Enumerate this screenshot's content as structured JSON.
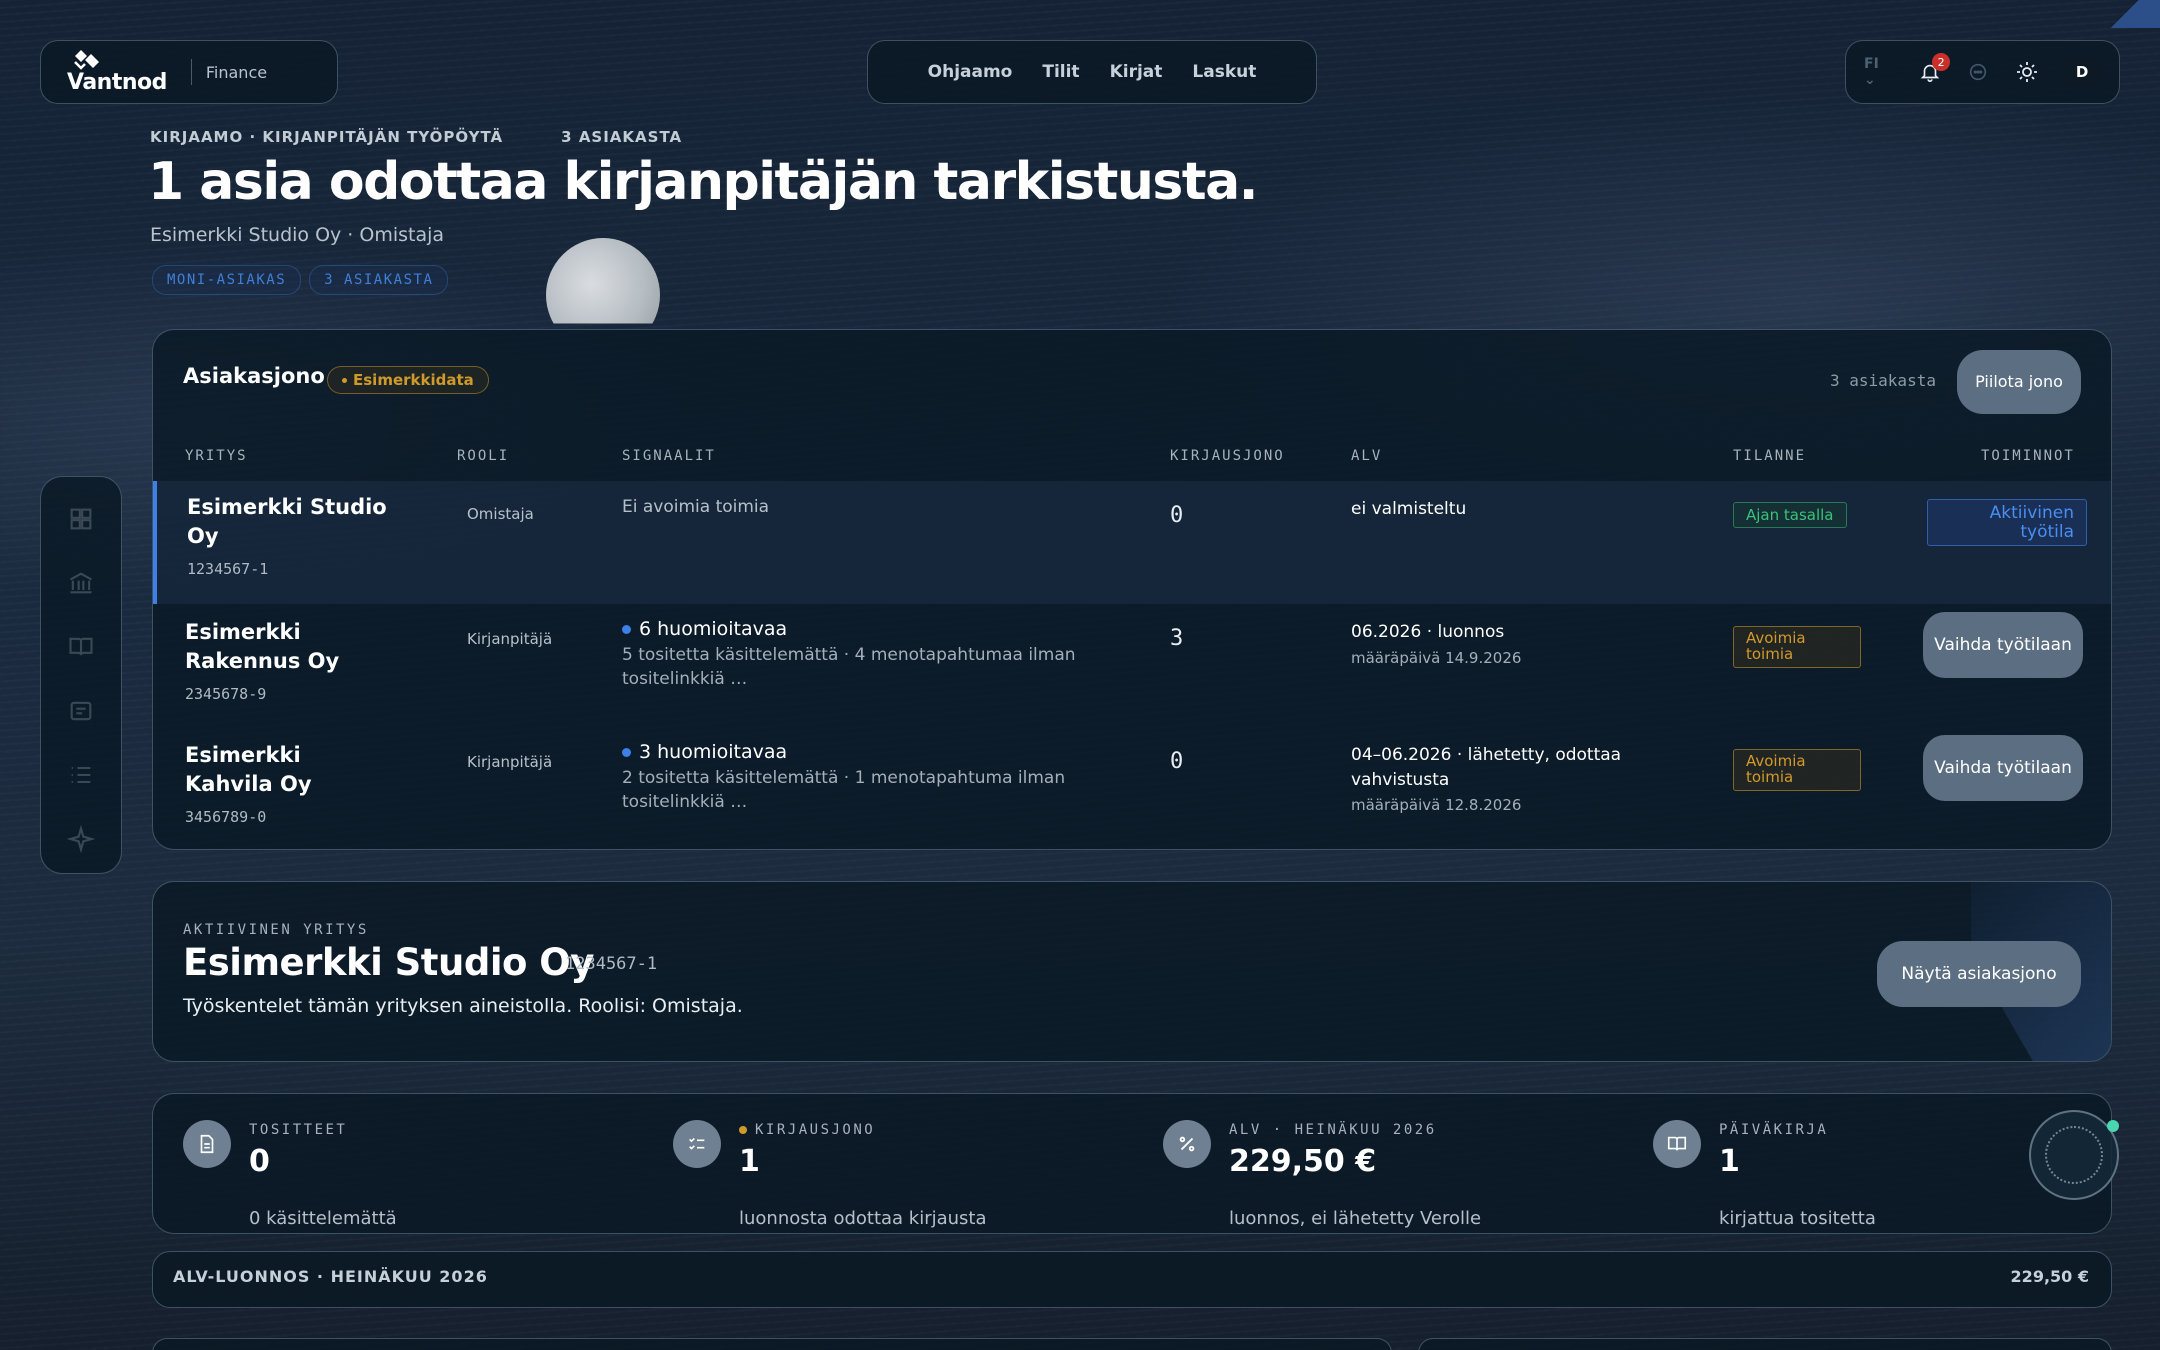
{
  "brand": {
    "name": "Vantnod",
    "product": "Finance"
  },
  "nav": {
    "items": [
      "Ohjaamo",
      "Tilit",
      "Kirjat",
      "Laskut"
    ]
  },
  "utility": {
    "lang": "FI",
    "notification_count": "2",
    "avatar_initial": "D"
  },
  "hero": {
    "eyebrow": "KIRJAAMO · KIRJANPITÄJÄN TYÖPÖYTÄ",
    "eyebrow_count": "3 ASIAKASTA",
    "headline": "1 asia odottaa kirjanpitäjän tarkistusta.",
    "subline": "Esimerkki Studio Oy · Omistaja",
    "chips": [
      "MONI-ASIAKAS",
      "3 ASIAKASTA"
    ]
  },
  "queue": {
    "title": "Asiakasjono",
    "demo_badge": "Esimerkkidata",
    "count": "3 asiakasta",
    "hide_button": "Piilota jono",
    "columns": [
      "YRITYS",
      "ROOLI",
      "SIGNAALIT",
      "KIRJAUSJONO",
      "ALV",
      "TILANNE",
      "TOIMINNOT"
    ],
    "rows": [
      {
        "name": "Esimerkki Studio Oy",
        "id": "1234567-1",
        "role": "Omistaja",
        "signal_none": "Ei avoimia toimia",
        "signal_main": "",
        "signal_sub": "",
        "queue": "0",
        "alv_main": "ei valmisteltu",
        "alv_sub": "",
        "status": "Ajan tasalla",
        "action": "Aktiivinen työtila"
      },
      {
        "name": "Esimerkki Rakennus Oy",
        "id": "2345678-9",
        "role": "Kirjanpitäjä",
        "signal_none": "",
        "signal_main": "6 huomioitavaa",
        "signal_sub": "5 tositetta käsittelemättä · 4 menotapahtumaa ilman tositelinkkiä …",
        "queue": "3",
        "alv_main": "06.2026 · luonnos",
        "alv_sub": "määräpäivä 14.9.2026",
        "status": "Avoimia toimia",
        "action": "Vaihda työtilaan"
      },
      {
        "name": "Esimerkki Kahvila Oy",
        "id": "3456789-0",
        "role": "Kirjanpitäjä",
        "signal_none": "",
        "signal_main": "3 huomioitavaa",
        "signal_sub": "2 tositetta käsittelemättä · 1 menotapahtuma ilman tositelinkkiä …",
        "queue": "0",
        "alv_main": "04–06.2026 · lähetetty, odottaa vahvistusta",
        "alv_sub": "määräpäivä 12.8.2026",
        "status": "Avoimia toimia",
        "action": "Vaihda työtilaan"
      }
    ]
  },
  "active_company": {
    "label": "AKTIIVINEN YRITYS",
    "name": "Esimerkki Studio Oy",
    "id": "1234567-1",
    "description": "Työskentelet tämän yrityksen aineistolla. Roolisi: Omistaja.",
    "button": "Näytä asiakasjono"
  },
  "stats": [
    {
      "label": "TOSITTEET",
      "value": "0",
      "sub": "0 käsittelemättä",
      "icon": "document-icon"
    },
    {
      "label": "KIRJAUSJONO",
      "value": "1",
      "sub": "luonnosta odottaa kirjausta",
      "icon": "checklist-icon"
    },
    {
      "label": "ALV · HEINÄKUU 2026",
      "value": "229,50 €",
      "sub": "luonnos, ei lähetetty Verolle",
      "icon": "percent-icon"
    },
    {
      "label": "PÄIVÄKIRJA",
      "value": "1",
      "sub": "kirjattua tositetta",
      "icon": "book-icon"
    }
  ],
  "alv_bar": {
    "label": "ALV-LUONNOS · HEINÄKUU 2026",
    "value": "229,50 €"
  },
  "colors": {
    "accent_blue": "#3c80e8",
    "ok_green": "#3ac27a",
    "warn_amber": "#d39a2b",
    "badge_red": "#c9302c"
  }
}
